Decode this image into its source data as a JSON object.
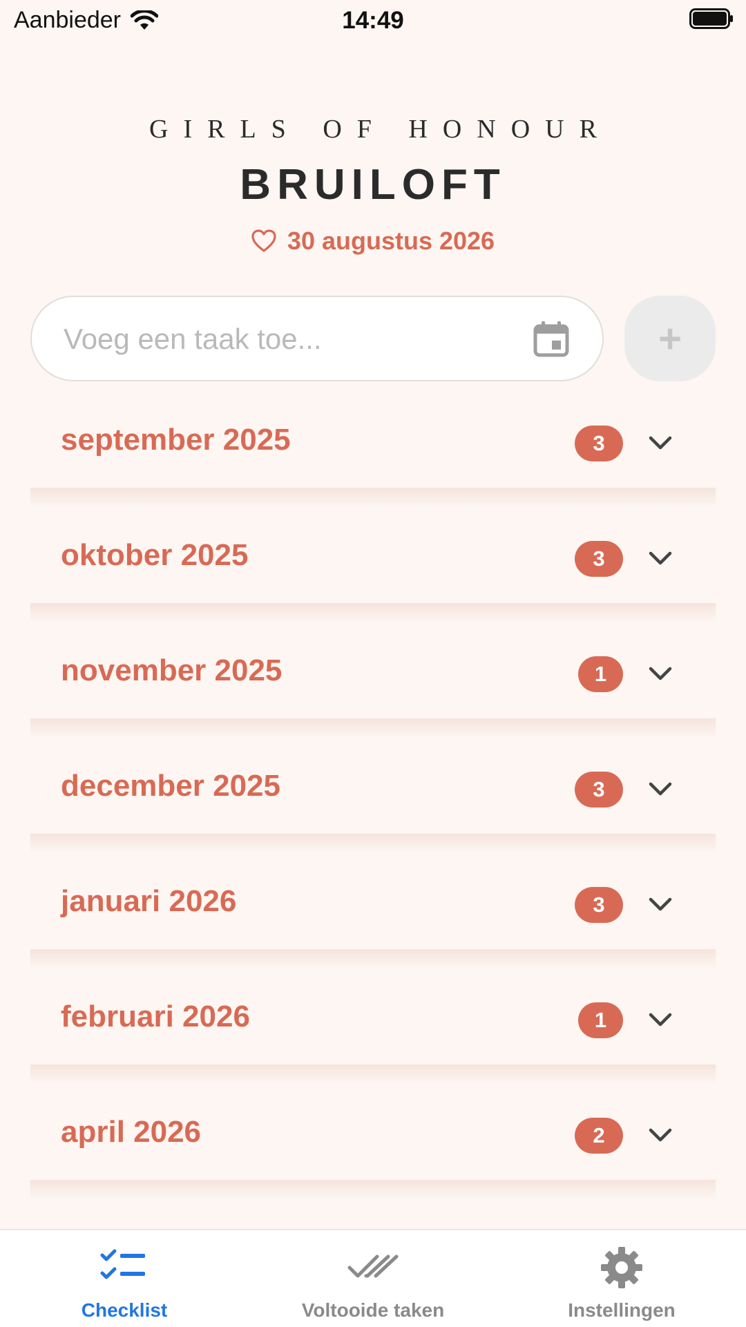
{
  "status_bar": {
    "carrier": "Aanbieder",
    "time": "14:49"
  },
  "header": {
    "brand": "GIRLS OF HONOUR",
    "title": "BRUILOFT",
    "wedding_date": "30 augustus 2026"
  },
  "task_input": {
    "placeholder": "Voeg een taak toe...",
    "value": ""
  },
  "add_button": {
    "label": "+"
  },
  "months": [
    {
      "label": "september 2025",
      "count": "3"
    },
    {
      "label": "oktober 2025",
      "count": "3"
    },
    {
      "label": "november 2025",
      "count": "1"
    },
    {
      "label": "december 2025",
      "count": "3"
    },
    {
      "label": "januari 2026",
      "count": "3"
    },
    {
      "label": "februari 2026",
      "count": "1"
    },
    {
      "label": "april 2026",
      "count": "2"
    }
  ],
  "tabs": [
    {
      "label": "Checklist",
      "icon": "checklist-icon",
      "active": true
    },
    {
      "label": "Voltooide taken",
      "icon": "double-check-icon",
      "active": false
    },
    {
      "label": "Instellingen",
      "icon": "gear-icon",
      "active": false
    }
  ],
  "colors": {
    "accent": "#d86a55",
    "background": "#fdf6f2",
    "tab_active": "#2176e3",
    "tab_inactive": "#8a8a8a"
  }
}
